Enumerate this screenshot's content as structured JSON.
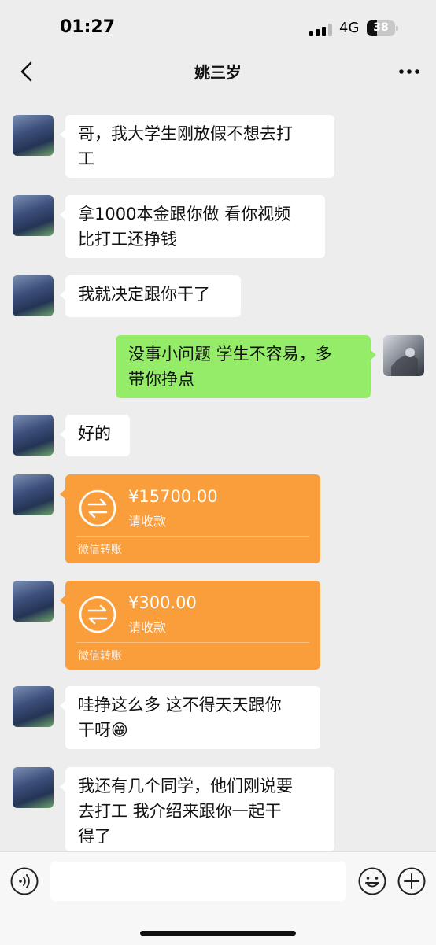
{
  "status": {
    "time": "01:27",
    "network": "4G",
    "battery": "38"
  },
  "nav": {
    "title": "姚三岁"
  },
  "messages": [
    {
      "side": "left",
      "type": "text",
      "lines": [
        "哥，我大学生刚放假不想去打",
        "工"
      ]
    },
    {
      "side": "left",
      "type": "text",
      "lines": [
        "拿1000本金跟你做 看你视频",
        "比打工还挣钱"
      ]
    },
    {
      "side": "left",
      "type": "text",
      "lines": [
        "我就决定跟你干了"
      ]
    },
    {
      "side": "right",
      "type": "text",
      "lines": [
        "没事小问题  学生不容易，多",
        "带你挣点"
      ]
    },
    {
      "side": "left",
      "type": "text",
      "lines": [
        "好的"
      ]
    },
    {
      "side": "left",
      "type": "transfer",
      "amount": "¥15700.00",
      "note": "请收款",
      "footer": "微信转账"
    },
    {
      "side": "left",
      "type": "transfer",
      "amount": "¥300.00",
      "note": "请收款",
      "footer": "微信转账"
    },
    {
      "side": "left",
      "type": "text",
      "lines": [
        "哇挣这么多 这不得天天跟你",
        "干呀😁"
      ]
    },
    {
      "side": "left",
      "type": "text",
      "lines": [
        "我还有几个同学，他们刚说要",
        "去打工 我介绍来跟你一起干",
        "得了"
      ]
    }
  ],
  "input": {
    "placeholder": "",
    "value": ""
  },
  "icons": {
    "back": "chevron-left-icon",
    "more": "more-dots-icon",
    "voice": "voice-icon",
    "emoji": "emoji-icon",
    "plus": "plus-icon",
    "transfer": "transfer-arrows-icon"
  },
  "colors": {
    "background": "#ededed",
    "sent_bubble": "#95ec69",
    "received_bubble": "#ffffff",
    "transfer_card": "#fa9d3b"
  }
}
